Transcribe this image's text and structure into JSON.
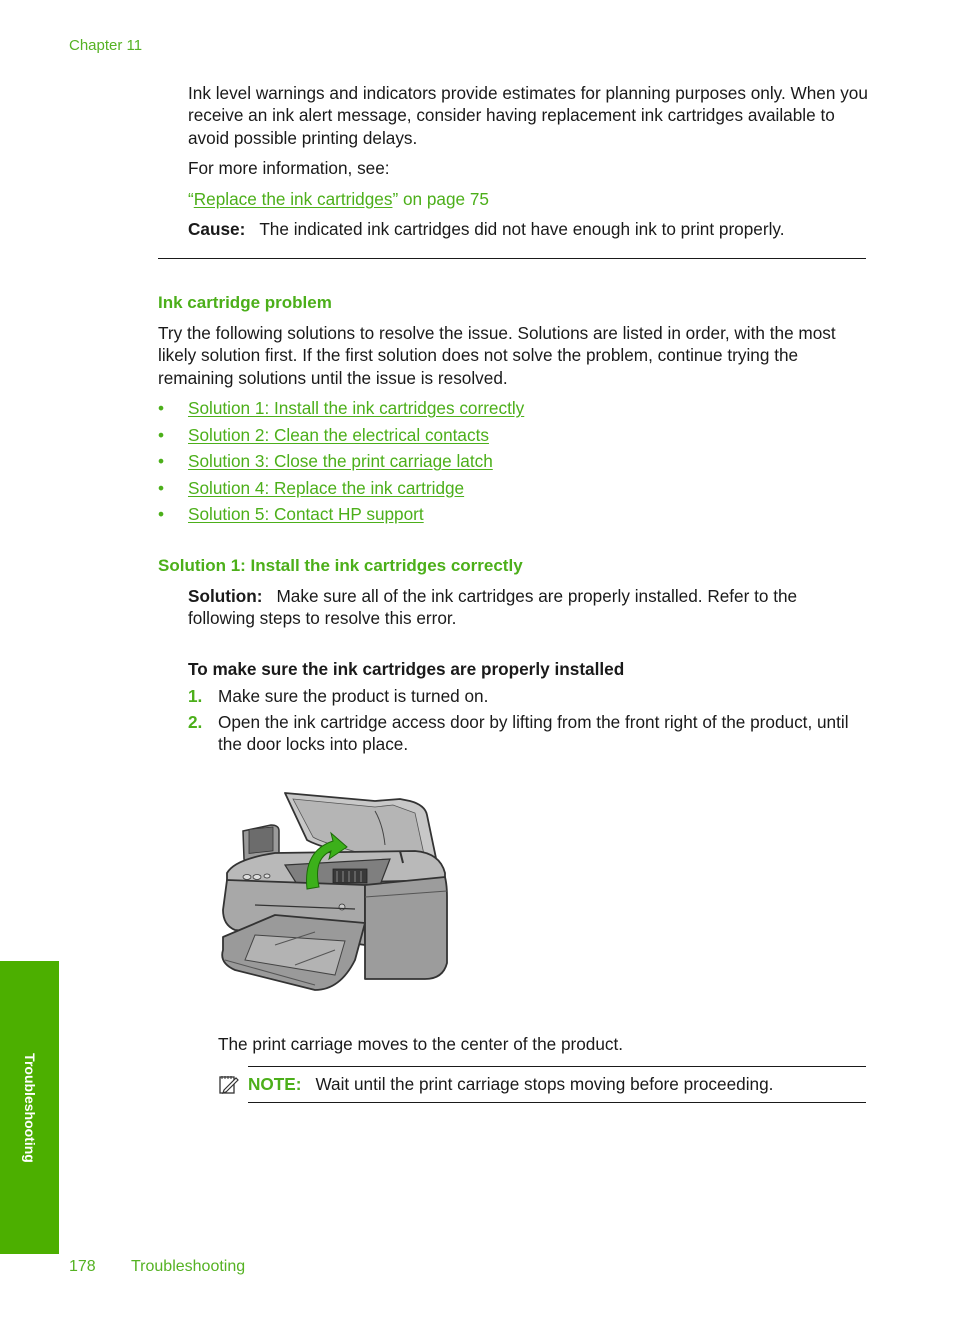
{
  "header": {
    "chapter": "Chapter 11"
  },
  "intro": {
    "paragraph": "Ink level warnings and indicators provide estimates for planning purposes only. When you receive an ink alert message, consider having replacement ink cartridges available to avoid possible printing delays.",
    "more_info": "For more information, see:",
    "open_quote": "“",
    "link_text": "Replace the ink cartridges",
    "link_suffix": "” on page 75",
    "cause_label": "Cause:",
    "cause_text": "The indicated ink cartridges did not have enough ink to print properly."
  },
  "section": {
    "title": "Ink cartridge problem",
    "paragraph": "Try the following solutions to resolve the issue. Solutions are listed in order, with the most likely solution first. If the first solution does not solve the problem, continue trying the remaining solutions until the issue is resolved.",
    "bullet": "•",
    "solutions": [
      {
        "label": "Solution 1: Install the ink cartridges correctly"
      },
      {
        "label": "Solution 2: Clean the electrical contacts"
      },
      {
        "label": "Solution 3: Close the print carriage latch"
      },
      {
        "label": "Solution 4: Replace the ink cartridge"
      },
      {
        "label": "Solution 5: Contact HP support"
      }
    ]
  },
  "solution1": {
    "title": "Solution 1: Install the ink cartridges correctly",
    "label": "Solution:",
    "text": "Make sure all of the ink cartridges are properly installed. Refer to the following steps to resolve this error.",
    "procedure_title": "To make sure the ink cartridges are properly installed",
    "steps": [
      {
        "num": "1.",
        "text": "Make sure the product is turned on."
      },
      {
        "num": "2.",
        "text": "Open the ink cartridge access door by lifting from the front right of the product, until the door locks into place."
      }
    ],
    "figure_alt": "printer with open ink cartridge access door",
    "after_figure": "The print carriage moves to the center of the product.",
    "note_label": "NOTE:",
    "note_text": "Wait until the print carriage stops moving before proceeding."
  },
  "side_tab": {
    "label": "Troubleshooting"
  },
  "footer": {
    "page_number": "178",
    "section": "Troubleshooting"
  },
  "colors": {
    "accent_green": "#4caf1a",
    "tab_green": "#4caf00"
  }
}
